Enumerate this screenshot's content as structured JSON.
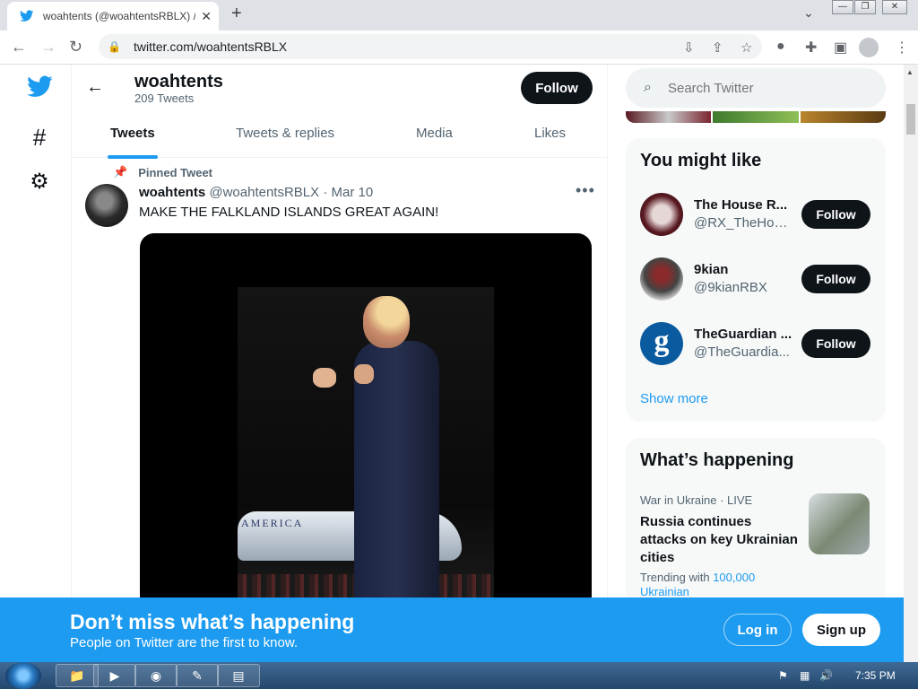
{
  "browser": {
    "tab_title": "woahtents (@woahtentsRBLX) / Twitter",
    "url": "twitter.com/woahtentsRBLX"
  },
  "profile": {
    "name": "woahtents",
    "tweet_count": "209 Tweets",
    "follow_label": "Follow",
    "tabs": [
      "Tweets",
      "Tweets & replies",
      "Media",
      "Likes"
    ]
  },
  "tweet": {
    "pinned_label": "Pinned Tweet",
    "display_name": "woahtents",
    "meta": "@woahtentsRBLX · Mar 10",
    "text": "MAKE THE FALKLAND ISLANDS GREAT AGAIN!",
    "media_caption_text": "AMERICA"
  },
  "sidebar": {
    "search_placeholder": "Search Twitter",
    "you_might_like": {
      "title": "You might like",
      "users": [
        {
          "name": "The House R...",
          "handle": "@RX_TheHouse",
          "follow": "Follow"
        },
        {
          "name": "9kian",
          "handle": "@9kianRBX",
          "follow": "Follow"
        },
        {
          "name": "TheGuardian ...",
          "handle": "@TheGuardia...",
          "follow": "Follow"
        }
      ],
      "show_more": "Show more"
    },
    "whats_happening": {
      "title": "What’s happening",
      "category": "War in Ukraine · LIVE",
      "headline": "Russia continues attacks on key Ukrainian cities",
      "trending_prefix": "Trending with",
      "trending_link": "100,000 Ukrainian"
    }
  },
  "bottom_bar": {
    "title": "Don’t miss what’s happening",
    "subtitle": "People on Twitter are the first to know.",
    "login": "Log in",
    "signup": "Sign up"
  },
  "taskbar": {
    "clock": "7:35 PM"
  },
  "colors": {
    "twitter_blue": "#1d9bf0",
    "text_primary": "#0f1419",
    "text_secondary": "#536471"
  }
}
